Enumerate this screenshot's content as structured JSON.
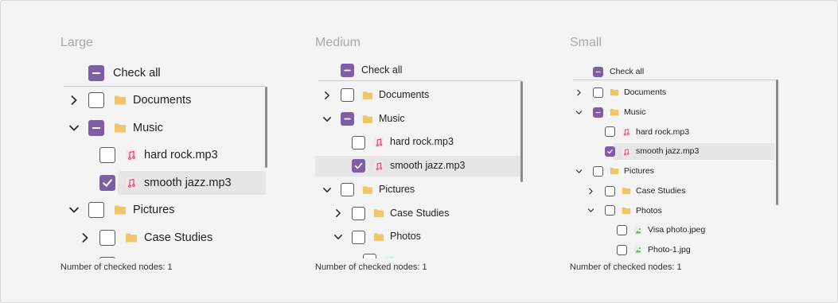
{
  "colors": {
    "accent": "#7e5ea5",
    "folder": "#f0c66a",
    "music": "#e0437a",
    "image": "#5aa86b"
  },
  "panels": [
    {
      "title": "Large",
      "check_all": {
        "label": "Check all",
        "state": "indeterminate"
      },
      "status": "Number of checked nodes: 1",
      "rows": [
        {
          "label": "Documents",
          "type": "folder",
          "depth": 0,
          "expander": "collapsed",
          "state": "unchecked"
        },
        {
          "label": "Music",
          "type": "folder",
          "depth": 0,
          "expander": "expanded",
          "state": "indeterminate"
        },
        {
          "label": "hard rock.mp3",
          "type": "music",
          "depth": 1,
          "expander": "none",
          "state": "unchecked"
        },
        {
          "label": "smooth jazz.mp3",
          "type": "music",
          "depth": 1,
          "expander": "none",
          "state": "checked",
          "selected": true
        },
        {
          "label": "Pictures",
          "type": "folder",
          "depth": 0,
          "expander": "expanded",
          "state": "unchecked"
        },
        {
          "label": "Case Studies",
          "type": "folder",
          "depth": 1,
          "expander": "collapsed",
          "state": "unchecked"
        },
        {
          "label": "",
          "type": "none",
          "depth": 1,
          "expander": "none",
          "state": "unchecked"
        }
      ]
    },
    {
      "title": "Medium",
      "check_all": {
        "label": "Check all",
        "state": "indeterminate"
      },
      "status": "Number of checked nodes: 1",
      "rows": [
        {
          "label": "Documents",
          "type": "folder",
          "depth": 0,
          "expander": "collapsed",
          "state": "unchecked"
        },
        {
          "label": "Music",
          "type": "folder",
          "depth": 0,
          "expander": "expanded",
          "state": "indeterminate"
        },
        {
          "label": "hard rock.mp3",
          "type": "music",
          "depth": 1,
          "expander": "none",
          "state": "unchecked"
        },
        {
          "label": "smooth jazz.mp3",
          "type": "music",
          "depth": 1,
          "expander": "none",
          "state": "checked",
          "selected": true
        },
        {
          "label": "Pictures",
          "type": "folder",
          "depth": 0,
          "expander": "expanded",
          "state": "unchecked"
        },
        {
          "label": "Case Studies",
          "type": "folder",
          "depth": 1,
          "expander": "collapsed",
          "state": "unchecked"
        },
        {
          "label": "Photos",
          "type": "folder",
          "depth": 1,
          "expander": "expanded",
          "state": "unchecked"
        },
        {
          "label": "",
          "type": "image",
          "depth": 2,
          "expander": "none",
          "state": "unchecked"
        }
      ]
    },
    {
      "title": "Small",
      "check_all": {
        "label": "Check all",
        "state": "indeterminate"
      },
      "status": "Number of checked nodes: 1",
      "rows": [
        {
          "label": "Documents",
          "type": "folder",
          "depth": 0,
          "expander": "collapsed",
          "state": "unchecked"
        },
        {
          "label": "Music",
          "type": "folder",
          "depth": 0,
          "expander": "expanded",
          "state": "indeterminate"
        },
        {
          "label": "hard rock.mp3",
          "type": "music",
          "depth": 1,
          "expander": "none",
          "state": "unchecked"
        },
        {
          "label": "smooth jazz.mp3",
          "type": "music",
          "depth": 1,
          "expander": "none",
          "state": "checked",
          "selected": true
        },
        {
          "label": "Pictures",
          "type": "folder",
          "depth": 0,
          "expander": "expanded",
          "state": "unchecked"
        },
        {
          "label": "Case Studies",
          "type": "folder",
          "depth": 1,
          "expander": "collapsed",
          "state": "unchecked"
        },
        {
          "label": "Photos",
          "type": "folder",
          "depth": 1,
          "expander": "expanded",
          "state": "unchecked"
        },
        {
          "label": "Visa photo.jpeg",
          "type": "image",
          "depth": 2,
          "expander": "none",
          "state": "unchecked"
        },
        {
          "label": "Photo-1.jpg",
          "type": "image",
          "depth": 2,
          "expander": "none",
          "state": "unchecked"
        }
      ]
    }
  ]
}
